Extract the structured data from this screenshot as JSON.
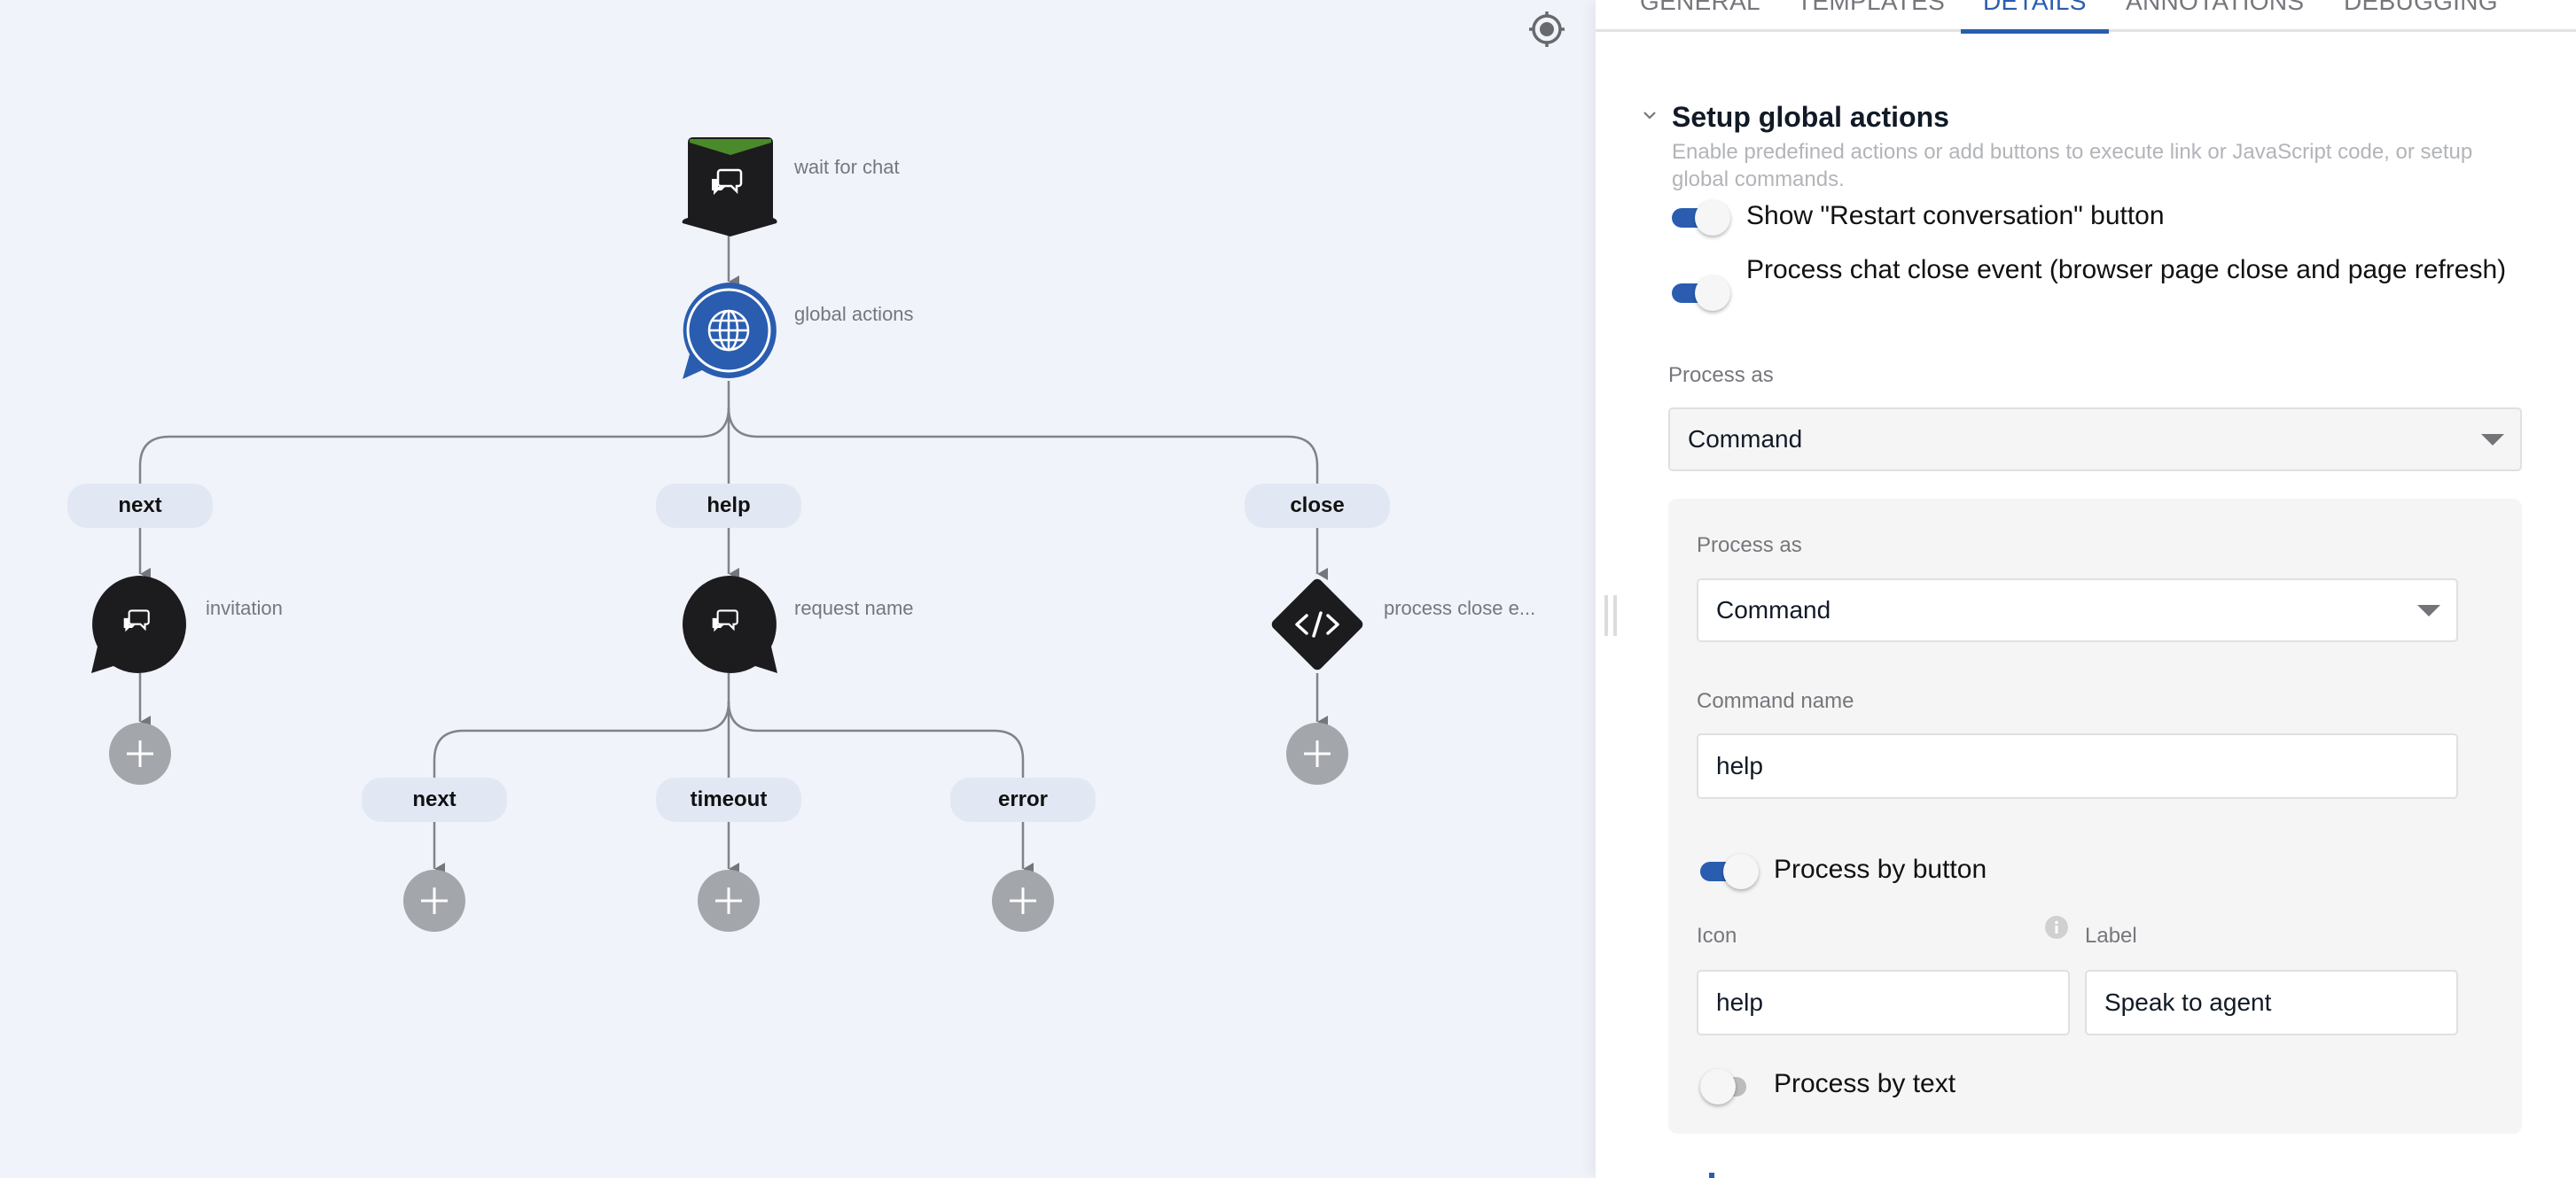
{
  "canvas": {
    "locate_icon": "crosshair-locate-icon",
    "nodes": {
      "wait_for_chat": {
        "label": "wait for chat",
        "icon": "chat-bubbles-icon",
        "accent": "#4a8a2a"
      },
      "global_actions": {
        "label": "global actions",
        "icon": "globe-icon",
        "color": "#2a5db0"
      },
      "invitation": {
        "label": "invitation",
        "icon": "chat-bubbles-icon"
      },
      "request_name": {
        "label": "request name",
        "icon": "chat-bubbles-icon"
      },
      "process_close": {
        "label": "process close e...",
        "icon": "code-icon",
        "glyph": "</>"
      }
    },
    "branches_global": [
      "next",
      "help",
      "close"
    ],
    "branches_request": [
      "next",
      "timeout",
      "error"
    ]
  },
  "panel": {
    "tabs": [
      {
        "label": "GENERAL",
        "active": false
      },
      {
        "label": "TEMPLATES",
        "active": false
      },
      {
        "label": "DETAILS",
        "active": true
      },
      {
        "label": "ANNOTATIONS",
        "active": false
      },
      {
        "label": "DEBUGGING",
        "active": false
      }
    ],
    "section": {
      "title": "Setup global actions",
      "description": "Enable predefined actions or add buttons to execute link or JavaScript code, or setup global commands."
    },
    "toggles": {
      "restart": {
        "label": "Show \"Restart conversation\" button",
        "on": true
      },
      "close_event": {
        "label": "Process chat close event (browser page close and page refresh)",
        "on": true
      },
      "by_button": {
        "label": "Process by button",
        "on": true
      },
      "by_text": {
        "label": "Process by text",
        "on": false
      }
    },
    "process_as": {
      "label": "Process as",
      "value": "Command"
    },
    "group": {
      "process_as": {
        "label": "Process as",
        "value": "Command"
      },
      "command_name": {
        "label": "Command name",
        "value": "help"
      },
      "icon": {
        "label": "Icon",
        "value": "help"
      },
      "button_label": {
        "label": "Label",
        "value": "Speak to agent"
      }
    },
    "colors": {
      "accent": "#2a5db0",
      "canvas_bg": "#f0f3f9"
    }
  }
}
